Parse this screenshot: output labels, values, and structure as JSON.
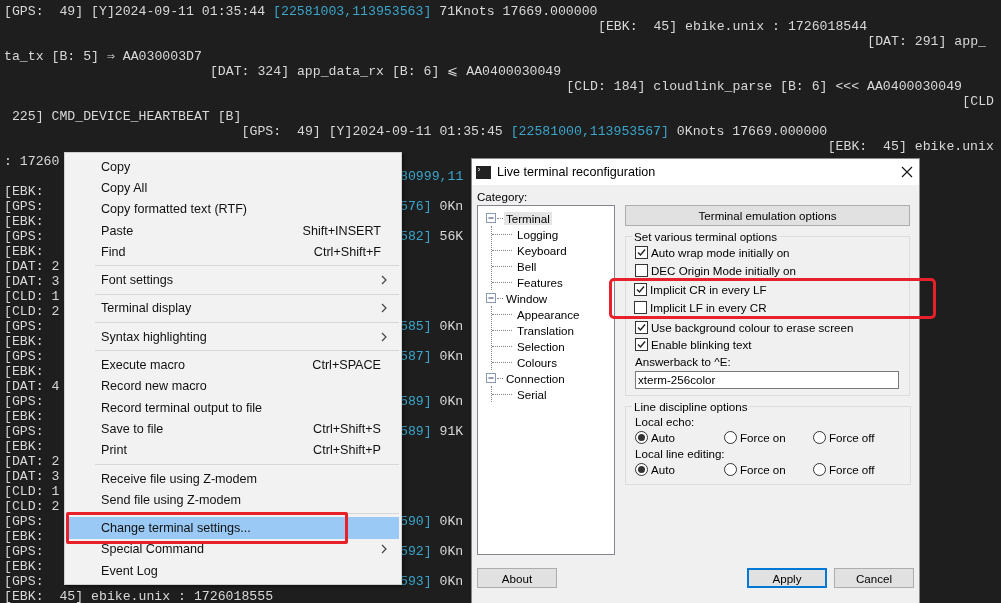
{
  "terminal": {
    "lines": [
      {
        "parts": [
          {
            "text": "[GPS:  49] [Y]2024-09-11 01:35:44",
            "kind": "plain"
          },
          {
            "text": "[22581003,113953563]",
            "kind": "coord"
          },
          {
            "text": "71Knots 17669.000000",
            "kind": "plain"
          }
        ]
      },
      {
        "parts": [
          {
            "text": "[EBK:  45] ebike.unix : 1726018544",
            "kind": "plain"
          }
        ]
      },
      {
        "parts": [
          {
            "text": "[DAT: 291] app_",
            "kind": "plain"
          }
        ]
      },
      {
        "parts": [
          {
            "text": "ta_tx [B: 5] ⇒ AA030003D7",
            "kind": "plain"
          }
        ]
      },
      {
        "parts": [
          {
            "text": "[DAT: 324] app_data_rx [B: 6] ⩽ AA0400030049",
            "kind": "plain"
          }
        ]
      },
      {
        "parts": [
          {
            "text": "[CLD: 184] cloudlink_parse [B: 6] <<< AA0400030049",
            "kind": "plain"
          }
        ]
      },
      {
        "parts": [
          {
            "text": "[CLD",
            "kind": "plain"
          }
        ]
      },
      {
        "parts": [
          {
            "text": "225] CMD_DEVICE_HEARTBEAT [B]",
            "kind": "plain"
          }
        ]
      },
      {
        "parts": [
          {
            "text": "[GPS:  49] [Y]2024-09-11 01:35:45",
            "kind": "plain"
          },
          {
            "text": "[22581000,113953567]",
            "kind": "coord"
          },
          {
            "text": "0Knots 17669.000000",
            "kind": "plain"
          }
        ]
      },
      {
        "parts": [
          {
            "text": "[EBK:  45] ebike.unix",
            "kind": "plain"
          }
        ]
      },
      {
        "parts": [
          {
            "text": ": 17260",
            "kind": "plain"
          }
        ]
      },
      {
        "parts": [
          {
            "text": "80999,11",
            "kind": "coord"
          }
        ]
      },
      {
        "parts": [
          {
            "text": "[EBK:",
            "kind": "plain"
          }
        ]
      },
      {
        "parts": [
          {
            "text": "[GPS:",
            "kind": "plain"
          },
          {
            "text": "576]",
            "kind": "coord"
          },
          {
            "text": "0Kn",
            "kind": "plain"
          }
        ]
      },
      {
        "parts": [
          {
            "text": "[EBK:",
            "kind": "plain"
          }
        ]
      },
      {
        "parts": [
          {
            "text": "[GPS:",
            "kind": "plain"
          },
          {
            "text": "582]",
            "kind": "coord"
          },
          {
            "text": "56K",
            "kind": "plain"
          }
        ]
      },
      {
        "parts": [
          {
            "text": "[EBK:",
            "kind": "plain"
          }
        ]
      },
      {
        "parts": [
          {
            "text": "[DAT: 2",
            "kind": "plain"
          }
        ]
      },
      {
        "parts": [
          {
            "text": "[DAT: 3",
            "kind": "plain"
          }
        ]
      },
      {
        "parts": [
          {
            "text": "[CLD: 1",
            "kind": "plain"
          }
        ]
      },
      {
        "parts": [
          {
            "text": "[CLD: 2",
            "kind": "plain"
          }
        ]
      },
      {
        "parts": [
          {
            "text": "[GPS:",
            "kind": "plain"
          },
          {
            "text": "585]",
            "kind": "coord"
          },
          {
            "text": "0Kn",
            "kind": "plain"
          }
        ]
      },
      {
        "parts": [
          {
            "text": "[EBK:",
            "kind": "plain"
          }
        ]
      },
      {
        "parts": [
          {
            "text": "[GPS:",
            "kind": "plain"
          },
          {
            "text": "587]",
            "kind": "coord"
          },
          {
            "text": "0Kn",
            "kind": "plain"
          }
        ]
      },
      {
        "parts": [
          {
            "text": "[EBK:",
            "kind": "plain"
          }
        ]
      },
      {
        "parts": [
          {
            "text": "[DAT: 4",
            "kind": "plain"
          }
        ]
      },
      {
        "parts": [
          {
            "text": "[GPS:",
            "kind": "plain"
          },
          {
            "text": "589]",
            "kind": "coord"
          },
          {
            "text": "0Kn",
            "kind": "plain"
          }
        ]
      },
      {
        "parts": [
          {
            "text": "[EBK:",
            "kind": "plain"
          }
        ]
      },
      {
        "parts": [
          {
            "text": "[GPS:",
            "kind": "plain"
          },
          {
            "text": "589]",
            "kind": "coord"
          },
          {
            "text": "91K",
            "kind": "plain"
          }
        ]
      },
      {
        "parts": [
          {
            "text": "[EBK:",
            "kind": "plain"
          }
        ]
      },
      {
        "parts": [
          {
            "text": "[DAT: 2",
            "kind": "plain"
          }
        ]
      },
      {
        "parts": [
          {
            "text": "[DAT: 3",
            "kind": "plain"
          }
        ]
      },
      {
        "parts": [
          {
            "text": "[CLD: 1",
            "kind": "plain"
          }
        ]
      },
      {
        "parts": [
          {
            "text": "[CLD: 2",
            "kind": "plain"
          }
        ]
      },
      {
        "parts": [
          {
            "text": "[GPS:",
            "kind": "plain"
          },
          {
            "text": "590]",
            "kind": "coord"
          },
          {
            "text": "0Kn",
            "kind": "plain"
          }
        ]
      },
      {
        "parts": [
          {
            "text": "[EBK:",
            "kind": "plain"
          }
        ]
      },
      {
        "parts": [
          {
            "text": "[GPS:",
            "kind": "plain"
          },
          {
            "text": "592]",
            "kind": "coord"
          },
          {
            "text": "0Kn",
            "kind": "plain"
          }
        ]
      },
      {
        "parts": [
          {
            "text": "[EBK:",
            "kind": "plain"
          }
        ]
      },
      {
        "parts": [
          {
            "text": "[GPS:",
            "kind": "plain"
          },
          {
            "text": "593]",
            "kind": "coord"
          },
          {
            "text": "0Kn",
            "kind": "plain"
          }
        ]
      },
      {
        "parts": [
          {
            "text": "[EBK:  45] ebike.unix : 1726018555",
            "kind": "plain"
          }
        ]
      }
    ]
  },
  "context_menu": {
    "items": [
      {
        "kind": "item",
        "label": "Copy",
        "selected": false
      },
      {
        "kind": "item",
        "label": "Copy All",
        "selected": false
      },
      {
        "kind": "item",
        "label": "Copy formatted text (RTF)",
        "selected": false
      },
      {
        "kind": "item",
        "label": "Paste",
        "shortcut": "Shift+INSERT",
        "selected": false
      },
      {
        "kind": "item",
        "label": "Find",
        "shortcut": "Ctrl+Shift+F",
        "selected": false
      },
      {
        "kind": "separator"
      },
      {
        "kind": "submenu",
        "label": "Font settings",
        "selected": false
      },
      {
        "kind": "separator"
      },
      {
        "kind": "submenu",
        "label": "Terminal display",
        "selected": false
      },
      {
        "kind": "separator"
      },
      {
        "kind": "submenu",
        "label": "Syntax highlighting",
        "selected": false
      },
      {
        "kind": "separator"
      },
      {
        "kind": "item",
        "label": "Execute macro",
        "shortcut": "Ctrl+SPACE",
        "selected": false
      },
      {
        "kind": "item",
        "label": "Record new macro",
        "selected": false
      },
      {
        "kind": "item",
        "label": "Record terminal output to file",
        "selected": false
      },
      {
        "kind": "item",
        "label": "Save to file",
        "shortcut": "Ctrl+Shift+S",
        "selected": false
      },
      {
        "kind": "item",
        "label": "Print",
        "shortcut": "Ctrl+Shift+P",
        "selected": false
      },
      {
        "kind": "separator"
      },
      {
        "kind": "item",
        "label": "Receive file using Z-modem",
        "selected": false
      },
      {
        "kind": "item",
        "label": "Send file using Z-modem",
        "selected": false
      },
      {
        "kind": "separator"
      },
      {
        "kind": "item",
        "label": "Change terminal settings...",
        "selected": true,
        "annotated": true
      },
      {
        "kind": "submenu",
        "label": "Special Command",
        "selected": false
      },
      {
        "kind": "item",
        "label": "Event Log",
        "selected": false
      }
    ]
  },
  "dialog": {
    "title": "Live terminal reconfiguration",
    "category_label": "Category:",
    "tree": [
      {
        "label": "Terminal",
        "selected": true,
        "expanded": true,
        "children": [
          {
            "label": "Logging",
            "selected": false
          },
          {
            "label": "Keyboard",
            "selected": false
          },
          {
            "label": "Bell",
            "selected": false
          },
          {
            "label": "Features",
            "selected": false
          }
        ]
      },
      {
        "label": "Window",
        "selected": false,
        "expanded": true,
        "children": [
          {
            "label": "Appearance",
            "selected": false
          },
          {
            "label": "Translation",
            "selected": false
          },
          {
            "label": "Selection",
            "selected": false
          },
          {
            "label": "Colours",
            "selected": false
          }
        ]
      },
      {
        "label": "Connection",
        "selected": false,
        "expanded": true,
        "children": [
          {
            "label": "Serial",
            "selected": false
          }
        ]
      }
    ],
    "panel_title": "Terminal emulation options",
    "options_group": {
      "title": "Set various terminal options",
      "checkboxes": [
        {
          "label": "Auto wrap mode initially on",
          "checked": true,
          "annotated": false
        },
        {
          "label": "DEC Origin Mode initially on",
          "checked": false,
          "annotated": false
        },
        {
          "label": "Implicit CR in every LF",
          "checked": true,
          "annotated": true
        },
        {
          "label": "Implicit LF in every CR",
          "checked": false,
          "annotated": true
        },
        {
          "label": "Use background colour to erase screen",
          "checked": true,
          "annotated": false
        },
        {
          "label": "Enable blinking text",
          "checked": true,
          "annotated": false
        }
      ],
      "answerback_label": "Answerback to ^E:",
      "answerback_value": "xterm-256color"
    },
    "line_discipline": {
      "title": "Line discipline options",
      "settings": [
        {
          "label": "Local echo:",
          "options": [
            {
              "label": "Auto",
              "selected": true
            },
            {
              "label": "Force on",
              "selected": false
            },
            {
              "label": "Force off",
              "selected": false
            }
          ]
        },
        {
          "label": "Local line editing:",
          "options": [
            {
              "label": "Auto",
              "selected": true
            },
            {
              "label": "Force on",
              "selected": false
            },
            {
              "label": "Force off",
              "selected": false
            }
          ]
        }
      ]
    },
    "buttons": [
      {
        "label": "About",
        "kind": "about"
      },
      {
        "label": "Apply",
        "kind": "default"
      },
      {
        "label": "Cancel",
        "kind": "normal"
      }
    ]
  }
}
